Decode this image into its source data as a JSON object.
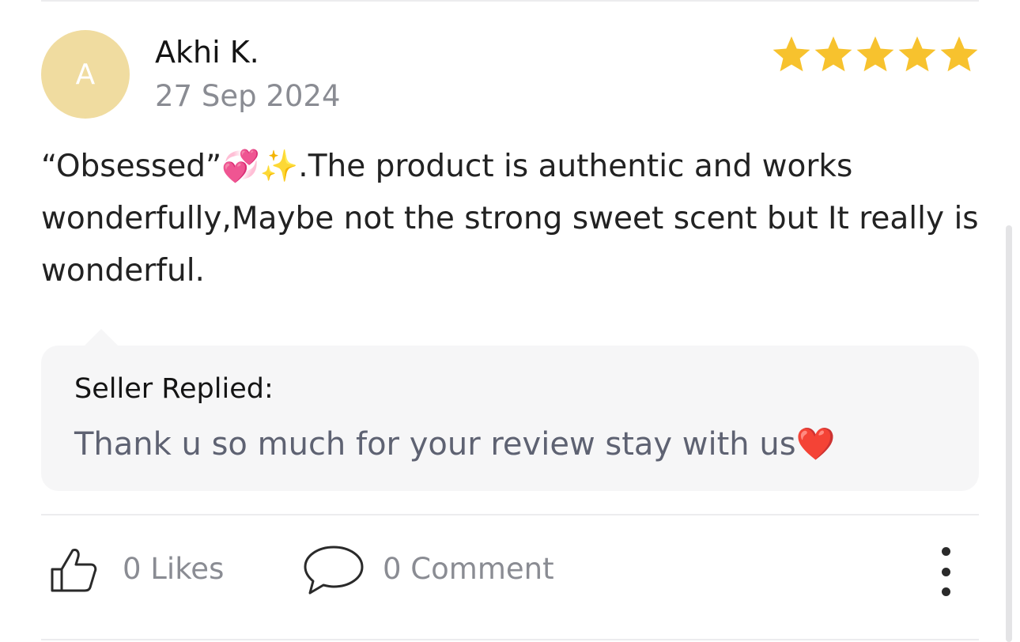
{
  "review": {
    "avatar_initial": "A",
    "reviewer_name": "Akhi K.",
    "date": "27 Sep 2024",
    "rating": 5,
    "rating_max": 5,
    "text": "“Obsessed”💞✨.The product is authentic and works wonderfully,Maybe not the strong sweet scent but It really is wonderful."
  },
  "reply": {
    "title": "Seller Replied:",
    "text": "Thank u so much for your review stay with us❤️"
  },
  "actions": {
    "likes_label": "0 Likes",
    "comments_label": "0 Comment"
  },
  "icons": {
    "star": "star-icon",
    "like": "thumbs-up-icon",
    "comment": "speech-bubble-icon",
    "more": "more-vertical-icon"
  },
  "colors": {
    "star": "#f7c22e",
    "avatar_bg": "#f0dca0",
    "muted_text": "#8a8c93",
    "reply_bg": "#f6f6f7"
  }
}
